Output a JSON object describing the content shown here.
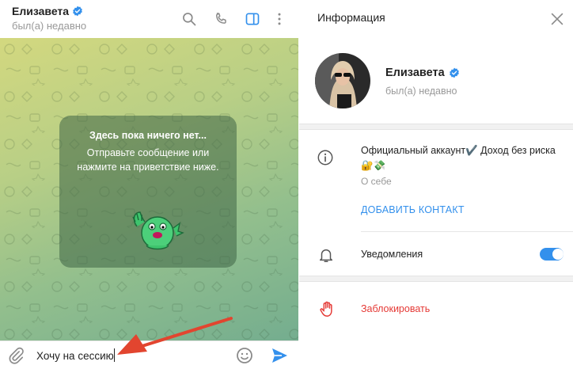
{
  "chat": {
    "peer_name": "Елизавета",
    "peer_status": "был(а) недавно",
    "empty_title": "Здесь пока ничего нет...",
    "empty_text": "Отправьте сообщение или нажмите на приветствие ниже.",
    "input_value": "Хочу на сессию",
    "header_icons": [
      "search-icon",
      "phone-icon",
      "sidebar-toggle-icon",
      "more-vert-icon"
    ]
  },
  "info": {
    "title": "Информация",
    "name": "Елизавета",
    "status": "был(а) недавно",
    "about": "Официальный аккаунт✔️ Доход без риска🔐💸",
    "about_label": "О себе",
    "add_contact": "ДОБАВИТЬ КОНТАКТ",
    "notifications_label": "Уведомления",
    "notifications_on": true,
    "block_label": "Заблокировать"
  },
  "colors": {
    "accent": "#3390ec",
    "danger": "#e53935",
    "verified": "#3390ec"
  }
}
